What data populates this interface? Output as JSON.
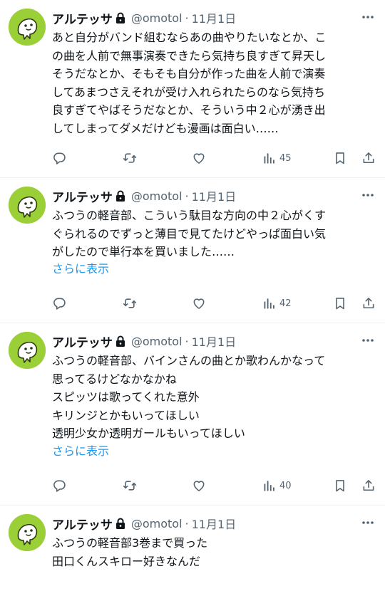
{
  "tweets": [
    {
      "name": "アルテッサ",
      "handle": "@omotol",
      "dot": "·",
      "date": "11月1日",
      "lines": [
        "あと自分がバンド組むならあの曲やりたいなとか、こ",
        "の曲を人前で無事演奏できたら気持ち良すぎて昇天し",
        "そうだなとか、そもそも自分が作った曲を人前で演奏",
        "してあまつさえそれが受け入れられたらのなら気持ち",
        "良すぎてやばそうだなとか、そういう中２心が湧き出",
        "してしまってダメだけども漫画は面白い……"
      ],
      "show_more": "",
      "views": "45"
    },
    {
      "name": "アルテッサ",
      "handle": "@omotol",
      "dot": "·",
      "date": "11月1日",
      "lines": [
        "ふつうの軽音部、こういう駄目な方向の中２心がくす",
        "ぐられるのでずっと薄目で見てたけどやっぱ面白い気",
        "がしたので単行本を買いました……"
      ],
      "show_more": "さらに表示",
      "views": "42"
    },
    {
      "name": "アルテッサ",
      "handle": "@omotol",
      "dot": "·",
      "date": "11月1日",
      "lines": [
        "ふつうの軽音部、バインさんの曲とか歌わんかなって",
        "思ってるけどなかなかね",
        "スピッツは歌ってくれた意外",
        "キリンジとかもいってほしい",
        "透明少女か透明ガールもいってほしい"
      ],
      "show_more": "さらに表示",
      "views": "40"
    },
    {
      "name": "アルテッサ",
      "handle": "@omotol",
      "dot": "·",
      "date": "11月1日",
      "lines": [
        "ふつうの軽音部3巻まで買った",
        "田口くんスキロー好きなんだ"
      ],
      "show_more": "",
      "views": ""
    }
  ],
  "icons": {
    "reply": "reply-icon",
    "retweet": "retweet-icon",
    "like": "like-icon",
    "views": "views-icon",
    "bookmark": "bookmark-icon",
    "share": "share-icon",
    "more": "more-icon",
    "lock": "lock-icon"
  },
  "colors": {
    "link": "#1d9bf0",
    "muted": "#536471",
    "avatar_bg": "#9bcf38"
  }
}
